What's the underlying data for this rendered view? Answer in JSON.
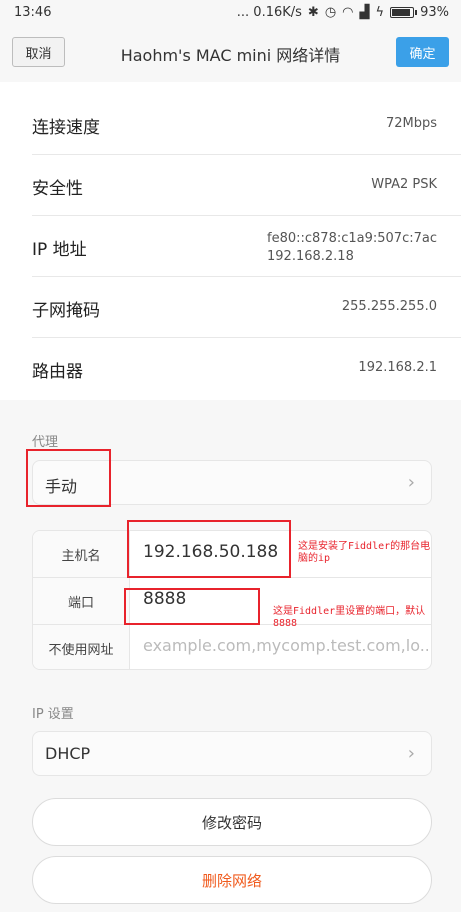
{
  "status_bar": {
    "time": "13:46",
    "net_speed": "... 0.16K/s",
    "battery": "93%"
  },
  "header": {
    "cancel_label": "取消",
    "title": "Haohm's  MAC  mini  网络详情",
    "confirm_label": "确定"
  },
  "details": [
    {
      "label": "连接速度",
      "value": "72Mbps"
    },
    {
      "label": "安全性",
      "value": "WPA2 PSK"
    },
    {
      "label": "IP 地址",
      "value_line1": "fe80::c878:c1a9:507c:7ac",
      "value_line2": "192.168.2.18"
    },
    {
      "label": "子网掩码",
      "value": "255.255.255.0"
    },
    {
      "label": "路由器",
      "value": "192.168.2.1"
    }
  ],
  "proxy": {
    "section_label": "代理",
    "mode": "手动",
    "host_label": "主机名",
    "host_value": "192.168.50.188",
    "port_label": "端口",
    "port_value": "8888",
    "bypass_label": "不使用网址",
    "bypass_placeholder": "example.com,mycomp.test.com,lo..."
  },
  "ip_settings": {
    "section_label": "IP 设置",
    "mode": "DHCP"
  },
  "buttons": {
    "change_password": "修改密码",
    "delete_network": "删除网络"
  },
  "annotations": {
    "host_note_line1": "这是安装了Fiddler的那台电",
    "host_note_line2": "脑的ip",
    "port_note_line1": "这是Fiddler里设置的端口，默认",
    "port_note_line2": "8888"
  },
  "colors": {
    "accent": "#3ba0e8",
    "danger": "#f05b1e",
    "annotation": "#e8232c"
  }
}
